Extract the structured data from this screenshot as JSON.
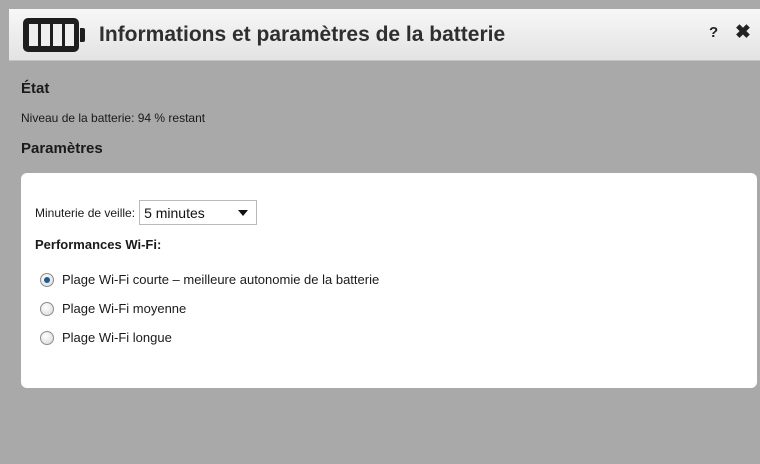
{
  "dialog": {
    "title": "Informations et paramètres de la batterie",
    "help_label": "?",
    "close_label": "✖"
  },
  "state": {
    "heading": "État",
    "battery_level_text": "Niveau de la batterie: 94 % restant"
  },
  "settings": {
    "heading": "Paramètres",
    "sleep_timer": {
      "label": "Minuterie de veille:",
      "selected_value": "5 minutes"
    },
    "wifi_performance": {
      "heading": "Performances Wi-Fi:",
      "options": [
        {
          "label": "Plage Wi-Fi courte – meilleure autonomie de la batterie",
          "checked": true
        },
        {
          "label": "Plage Wi-Fi moyenne",
          "checked": false
        },
        {
          "label": "Plage Wi-Fi longue",
          "checked": false
        }
      ]
    }
  },
  "icons": {
    "battery": "battery-full-icon",
    "help": "help-icon",
    "close": "close-icon"
  }
}
